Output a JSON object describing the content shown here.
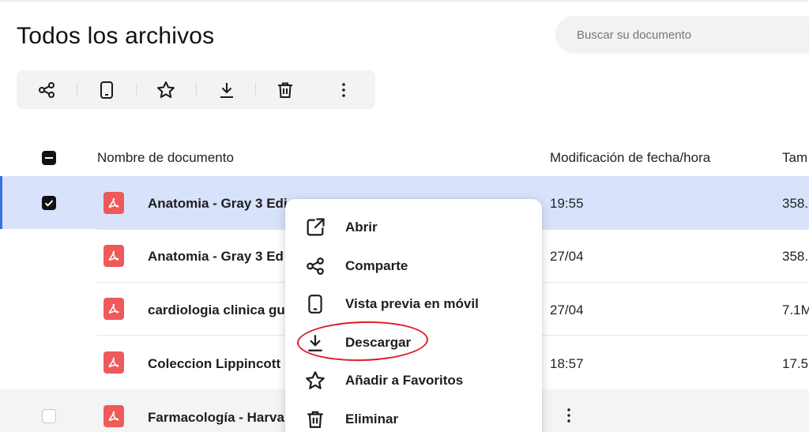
{
  "page": {
    "title": "Todos los archivos",
    "search_placeholder": "Buscar su documento"
  },
  "toolbar": {
    "icons": [
      "share-icon",
      "mobile-preview-icon",
      "star-icon",
      "download-icon",
      "trash-icon",
      "more-vertical-icon"
    ]
  },
  "table": {
    "columns": [
      "Nombre de documento",
      "Modificación de fecha/hora",
      "Tam"
    ],
    "rows": [
      {
        "name": "Anatomia - Gray 3 Edi",
        "date": "19:55",
        "size": "358.",
        "checked": true,
        "state": "selected"
      },
      {
        "name": "Anatomia - Gray 3 Ed",
        "date": "27/04",
        "size": "358.",
        "checked": false,
        "state": "normal"
      },
      {
        "name": "cardiologia clinica gu",
        "date": "27/04",
        "size": "7.1M",
        "checked": false,
        "state": "normal"
      },
      {
        "name": "Coleccion Lippincott",
        "date": "18:57",
        "size": "17.5",
        "checked": false,
        "state": "normal"
      },
      {
        "name": "Farmacología - Harvard",
        "date": "",
        "size": "",
        "checked": false,
        "state": "hover"
      }
    ]
  },
  "context_menu": {
    "items": [
      {
        "label": "Abrir",
        "icon": "open-external-icon"
      },
      {
        "label": "Comparte",
        "icon": "share-icon"
      },
      {
        "label": "Vista previa en móvil",
        "icon": "mobile-preview-icon"
      },
      {
        "label": "Descargar",
        "icon": "download-icon"
      },
      {
        "label": "Añadir a Favoritos",
        "icon": "star-icon"
      },
      {
        "label": "Eliminar",
        "icon": "trash-icon"
      }
    ],
    "highlighted_item": "Descargar"
  },
  "colors": {
    "selected_row": "#d8e3fb",
    "selection_accent": "#3b6fe0",
    "pdf_icon": "#ee5a5a",
    "annotation": "#e01b24"
  }
}
